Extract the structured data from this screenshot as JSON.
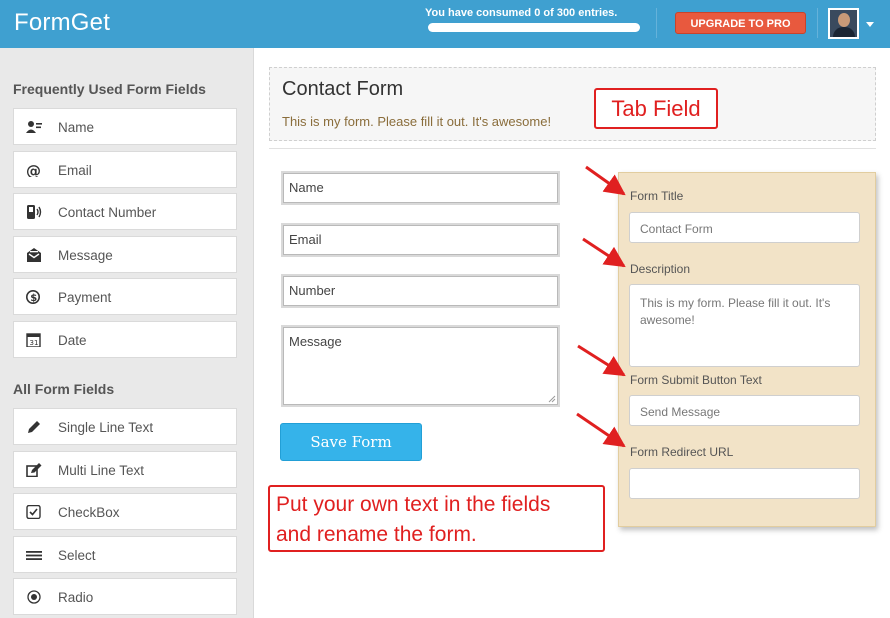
{
  "header": {
    "logo": "FormGet",
    "usage_text": "You have consumed 0 of 300 entries.",
    "usage_fraction": 0,
    "upgrade_label": "UPGRADE TO PRO",
    "brand_color": "#3fa0d0",
    "upgrade_color": "#e8593e"
  },
  "sidebar": {
    "frequent_heading": "Frequently Used Form Fields",
    "frequent": [
      {
        "label": "Name",
        "icon": "person-card-icon"
      },
      {
        "label": "Email",
        "icon": "at-icon"
      },
      {
        "label": "Contact Number",
        "icon": "phone-icon"
      },
      {
        "label": "Message",
        "icon": "envelope-icon"
      },
      {
        "label": "Payment",
        "icon": "dollar-icon"
      },
      {
        "label": "Date",
        "icon": "calendar-icon"
      }
    ],
    "all_heading": "All Form Fields",
    "all": [
      {
        "label": "Single Line Text",
        "icon": "pencil-icon"
      },
      {
        "label": "Multi Line Text",
        "icon": "edit-icon"
      },
      {
        "label": "CheckBox",
        "icon": "checkbox-icon"
      },
      {
        "label": "Select",
        "icon": "list-icon"
      },
      {
        "label": "Radio",
        "icon": "radio-icon"
      }
    ]
  },
  "form": {
    "title": "Contact Form",
    "description": "This is my form. Please fill it out. It's awesome!",
    "fields": {
      "name": "Name",
      "email": "Email",
      "number": "Number",
      "message": "Message"
    },
    "save_label": "Save Form"
  },
  "settings": {
    "form_title_label": "Form Title",
    "form_title_value": "Contact Form",
    "description_label": "Description",
    "description_value": "This is my form. Please fill it out. It's awesome!",
    "submit_label": "Form Submit Button Text",
    "submit_value": "Send Message",
    "redirect_label": "Form Redirect URL",
    "redirect_value": ""
  },
  "annotations": {
    "tab_field": "Tab Field",
    "instruction_line1": "Put your own text in the fields",
    "instruction_line2": "and rename the form.",
    "annotation_color": "#e02020"
  }
}
